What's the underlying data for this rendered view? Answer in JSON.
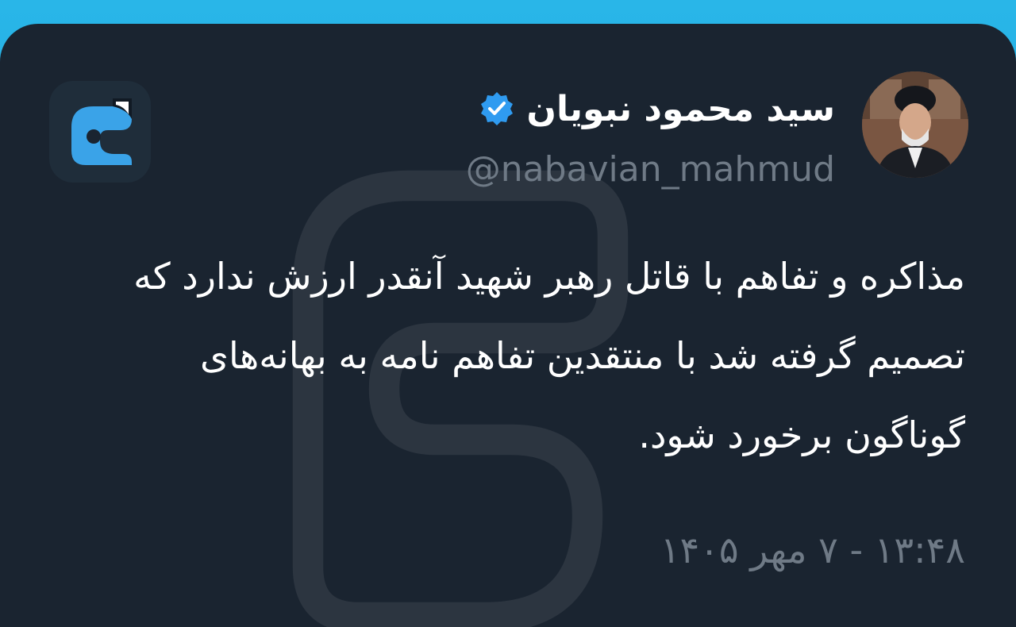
{
  "author": {
    "display_name": "سید محمود نبویان",
    "handle": "@nabavian_mahmud",
    "verified": true,
    "avatar_icon": "profile-photo"
  },
  "tweet": {
    "text": "مذاکره و تفاهم با قاتل رهبر شهید آنقدر ارزش ندارد که تصمیم گرفته شد با منتقدین تفاهم نامه به بهانه‌های گوناگون برخورد شود.",
    "timestamp": "۱۳:۴۸ - ۷ مهر ۱۴۰۵"
  },
  "app": {
    "logo_icon": "app-logo-icon"
  },
  "colors": {
    "background": "#1a2430",
    "frame_accent": "#29b6e8",
    "secondary_text": "#6f7a86",
    "verified_badge": "#2f9bf0",
    "logo_blue": "#3aa3e8"
  }
}
